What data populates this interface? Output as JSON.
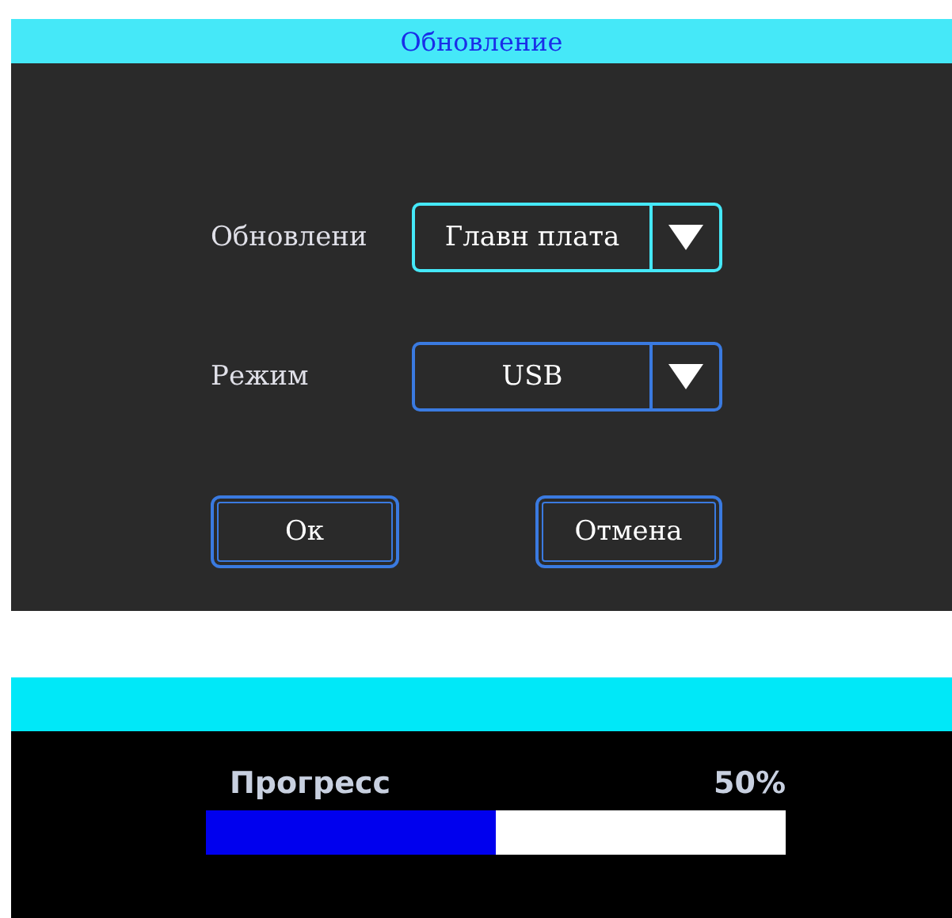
{
  "update_dialog": {
    "title": "Обновление",
    "fields": [
      {
        "label": "Обновлени",
        "value": "Главн плата",
        "selected": true
      },
      {
        "label": "Режим",
        "value": "USB",
        "selected": false
      }
    ],
    "buttons": [
      "Ок",
      "Отмена"
    ]
  },
  "progress_screen": {
    "label": "Прогресс",
    "reading": "50%",
    "level": 0.5
  }
}
